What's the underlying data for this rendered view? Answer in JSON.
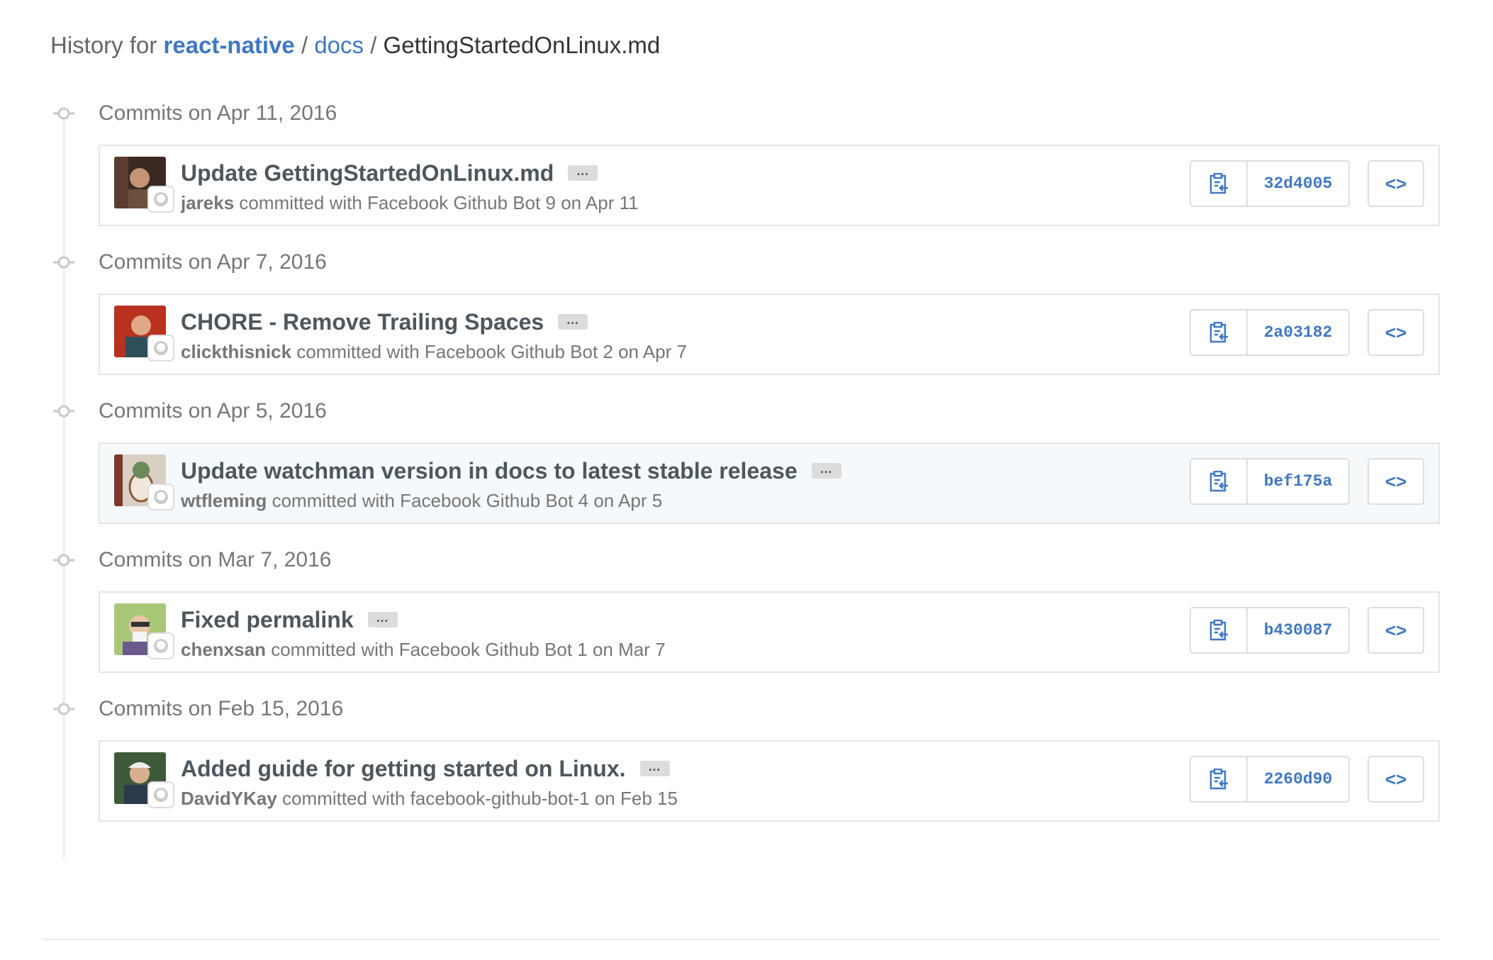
{
  "header": {
    "prefix": "History for",
    "repo": "react-native",
    "sep1": "/",
    "dir": "docs",
    "sep2": "/",
    "file": "GettingStartedOnLinux.md"
  },
  "colors": {
    "link": "#4078c0",
    "highlight_row": "#f5f9fc"
  },
  "icons": {
    "timeline": "commit-node-icon",
    "copy": "clipboard-icon",
    "browse": "code-icon",
    "bot": "github-octocat-icon"
  },
  "ellipsis": "…",
  "browse_label": "<>",
  "groups": [
    {
      "date": "Commits on Apr 11, 2016",
      "commit": {
        "message": "Update GettingStartedOnLinux.md",
        "author": "jareks",
        "rest": "committed with Facebook Github Bot 9 on Apr 11",
        "sha": "32d4005"
      }
    },
    {
      "date": "Commits on Apr 7, 2016",
      "commit": {
        "message": "CHORE - Remove Trailing Spaces",
        "author": "clickthisnick",
        "rest": "committed with Facebook Github Bot 2 on Apr 7",
        "sha": "2a03182"
      }
    },
    {
      "date": "Commits on Apr 5, 2016",
      "commit": {
        "message": "Update watchman version in docs to latest stable release",
        "author": "wtfleming",
        "rest": "committed with Facebook Github Bot 4 on Apr 5",
        "sha": "bef175a"
      }
    },
    {
      "date": "Commits on Mar 7, 2016",
      "commit": {
        "message": "Fixed permalink",
        "author": "chenxsan",
        "rest": "committed with Facebook Github Bot 1 on Mar 7",
        "sha": "b430087"
      }
    },
    {
      "date": "Commits on Feb 15, 2016",
      "commit": {
        "message": "Added guide for getting started on Linux.",
        "author": "DavidYKay",
        "rest": "committed with facebook-github-bot-1 on Feb 15",
        "sha": "2260d90"
      }
    }
  ]
}
